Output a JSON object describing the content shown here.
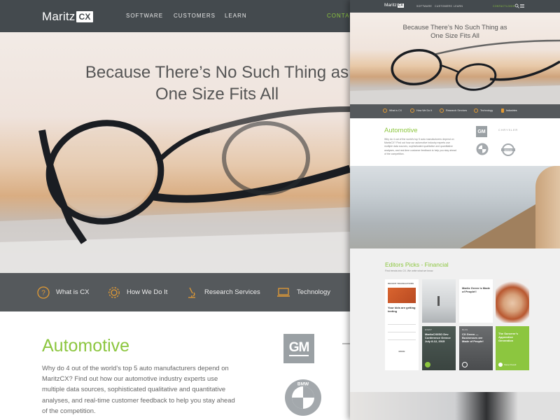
{
  "main": {
    "logo": {
      "text": "Maritz",
      "badge": "CX"
    },
    "nav": {
      "software": "SOFTWARE",
      "customers": "CUSTOMERS",
      "learn": "LEARN",
      "contact": "CONTAC"
    },
    "hero": {
      "title_line1": "Because There’s No Such Thing as",
      "title_line2": "One Size Fits All"
    },
    "features": [
      {
        "label": "What is CX",
        "icon": "question-icon"
      },
      {
        "label": "How We Do It",
        "icon": "gear-icon"
      },
      {
        "label": "Research Services",
        "icon": "microscope-icon"
      },
      {
        "label": "Technology",
        "icon": "laptop-icon"
      }
    ],
    "automotive": {
      "title": "Automotive",
      "body": "Why do 4 out of the world’s top 5 auto manufacturers depend on MaritzCX? Find out how our automotive industry experts use multiple data sources, sophisticated qualitative and quantitative analyses, and real-time customer feedback to help you stay ahead of the competition."
    },
    "logos": {
      "gm": "GM",
      "bmw": "BMW"
    }
  },
  "mobile": {
    "logo": {
      "text": "Maritz",
      "badge": "CX"
    },
    "nav": {
      "software": "SOFTWARE",
      "customers": "CUSTOMERS",
      "learn": "LEARN",
      "contact": "CONTACT",
      "login": "LOGIN"
    },
    "hero": {
      "title_line1": "Because There’s No Such Thing as",
      "title_line2": "One Size Fits All"
    },
    "features": [
      {
        "label": "What is CX"
      },
      {
        "label": "How We Do It"
      },
      {
        "label": "Research Services"
      },
      {
        "label": "Technology"
      },
      {
        "label": "Industries"
      }
    ],
    "automotive": {
      "title": "Automotive",
      "body": "Why do 4 out of the world’s top 5 auto manufacturers depend on MaritzCX? Find out how our automotive industry experts use multiple data sources, sophisticated qualitative and quantitative analyses, and real-time customer feedback to help you stay ahead of the competition."
    },
    "logos": {
      "gm": "GM",
      "chrysler": "CHRYSLER",
      "bmw": "BMW",
      "nissan": "NISSAN"
    },
    "editors": {
      "title": "Editors Picks - Financial",
      "subtitle": "Find trends into CX. We write what we know.",
      "cards": [
        {
          "tag": "RECENT TRANSACTIONS",
          "title": "Your kids are getting texting",
          "more": "MORE"
        },
        {
          "title": "Maritz Green is Made of People!!"
        },
        {
          "tag": "EVENT",
          "title": "MaritzCX/ISO Dev Conference Greece July 8-12, 2015"
        },
        {
          "tag": "BLOG",
          "title": "CX Green — Businesses are Made of People!"
        },
        {
          "title": "The Sorcerer’s Apprentice Generation",
          "author": "Steve Powell"
        }
      ]
    }
  }
}
